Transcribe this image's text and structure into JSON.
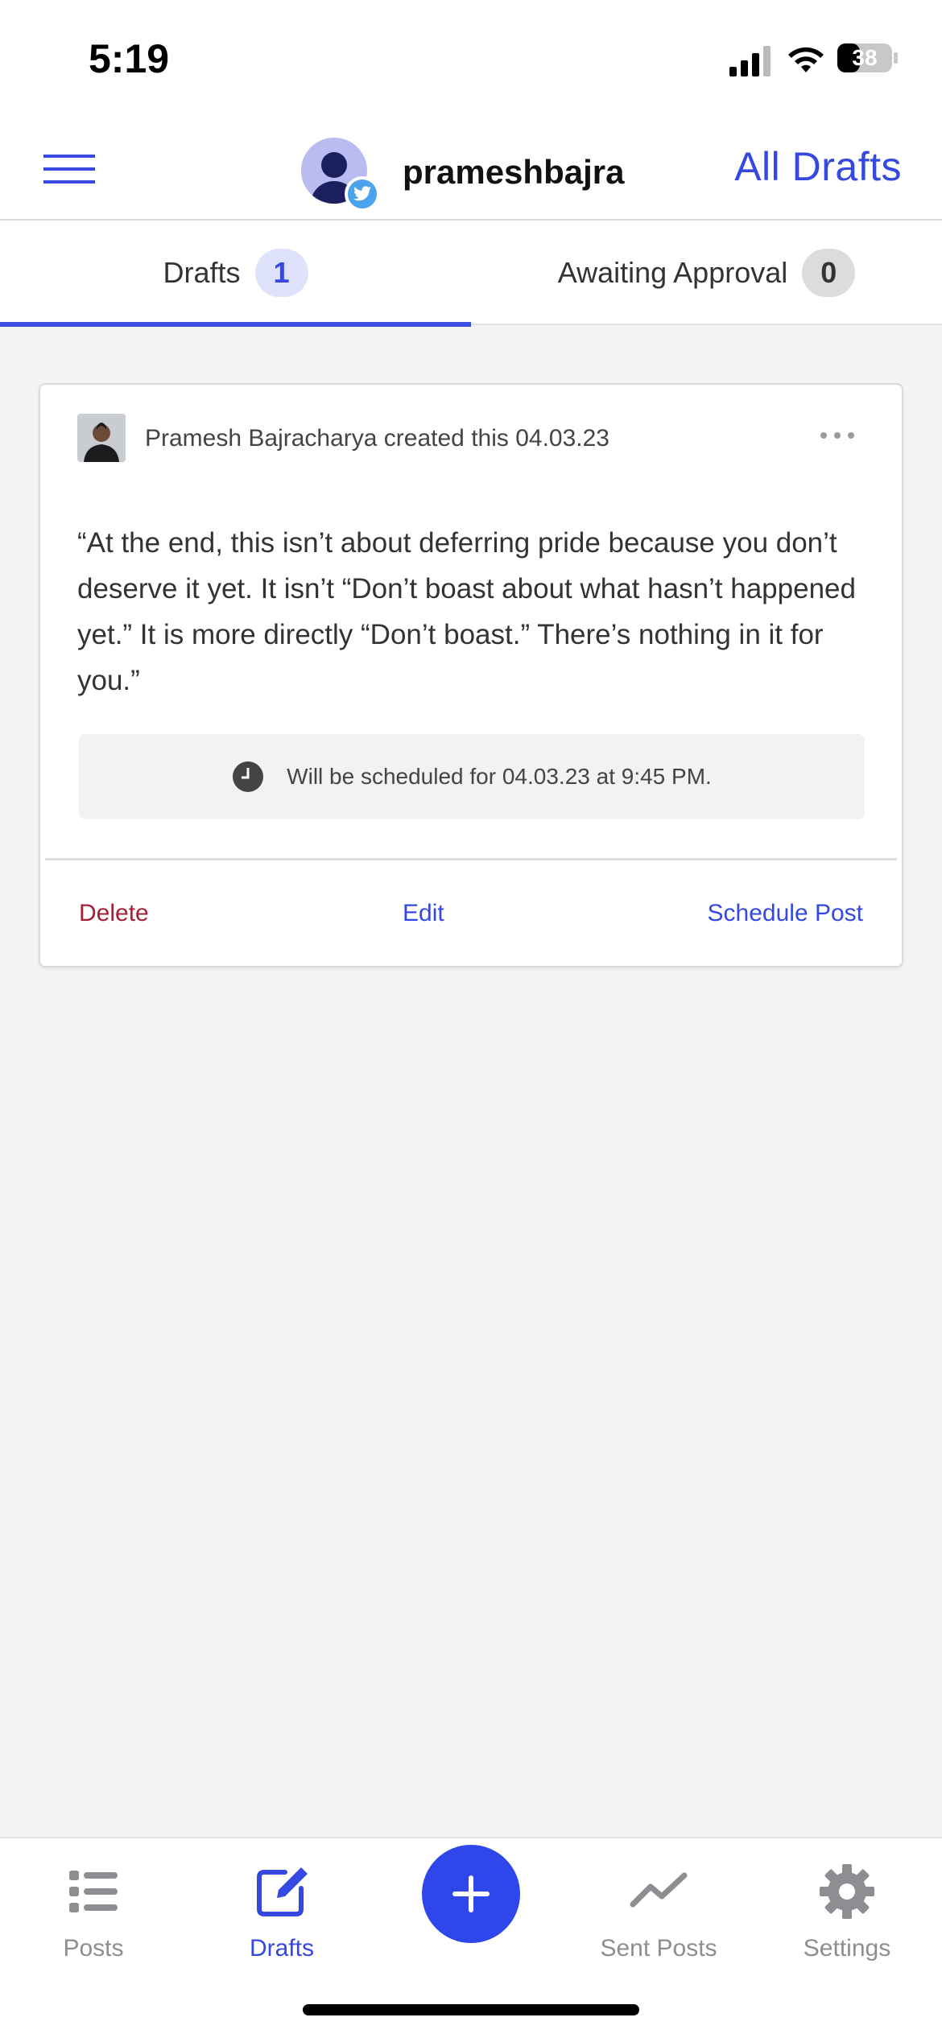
{
  "status_bar": {
    "time": "5:19",
    "battery": "38"
  },
  "header": {
    "username": "prameshbajra",
    "all_drafts_label": "All Drafts",
    "menu_icon": "hamburger-menu-icon",
    "badge_icon": "twitter-icon"
  },
  "tabs": [
    {
      "label": "Drafts",
      "count": "1",
      "active": true
    },
    {
      "label": "Awaiting Approval",
      "count": "0",
      "active": false
    }
  ],
  "draft": {
    "author_line": "Pramesh Bajracharya created this 04.03.23",
    "text": "“At the end, this isn’t about deferring pride because you don’t deserve it yet. It isn’t “Don’t boast about what hasn’t happened yet.” It is more directly “Don’t boast.” There’s nothing in it for you.”",
    "schedule_text": "Will be scheduled for 04.03.23 at 9:45 PM.",
    "actions": {
      "delete": "Delete",
      "edit": "Edit",
      "schedule": "Schedule Post"
    }
  },
  "bottom_nav": {
    "items": [
      {
        "label": "Posts",
        "icon": "list-icon",
        "active": false
      },
      {
        "label": "Drafts",
        "icon": "edit-icon",
        "active": true
      },
      {
        "label": "Sent Posts",
        "icon": "trend-icon",
        "active": false
      },
      {
        "label": "Settings",
        "icon": "gear-icon",
        "active": false
      }
    ],
    "fab_icon": "plus-icon"
  },
  "colors": {
    "accent": "#3548e0",
    "danger": "#a32036",
    "background": "#f4f4f5"
  }
}
